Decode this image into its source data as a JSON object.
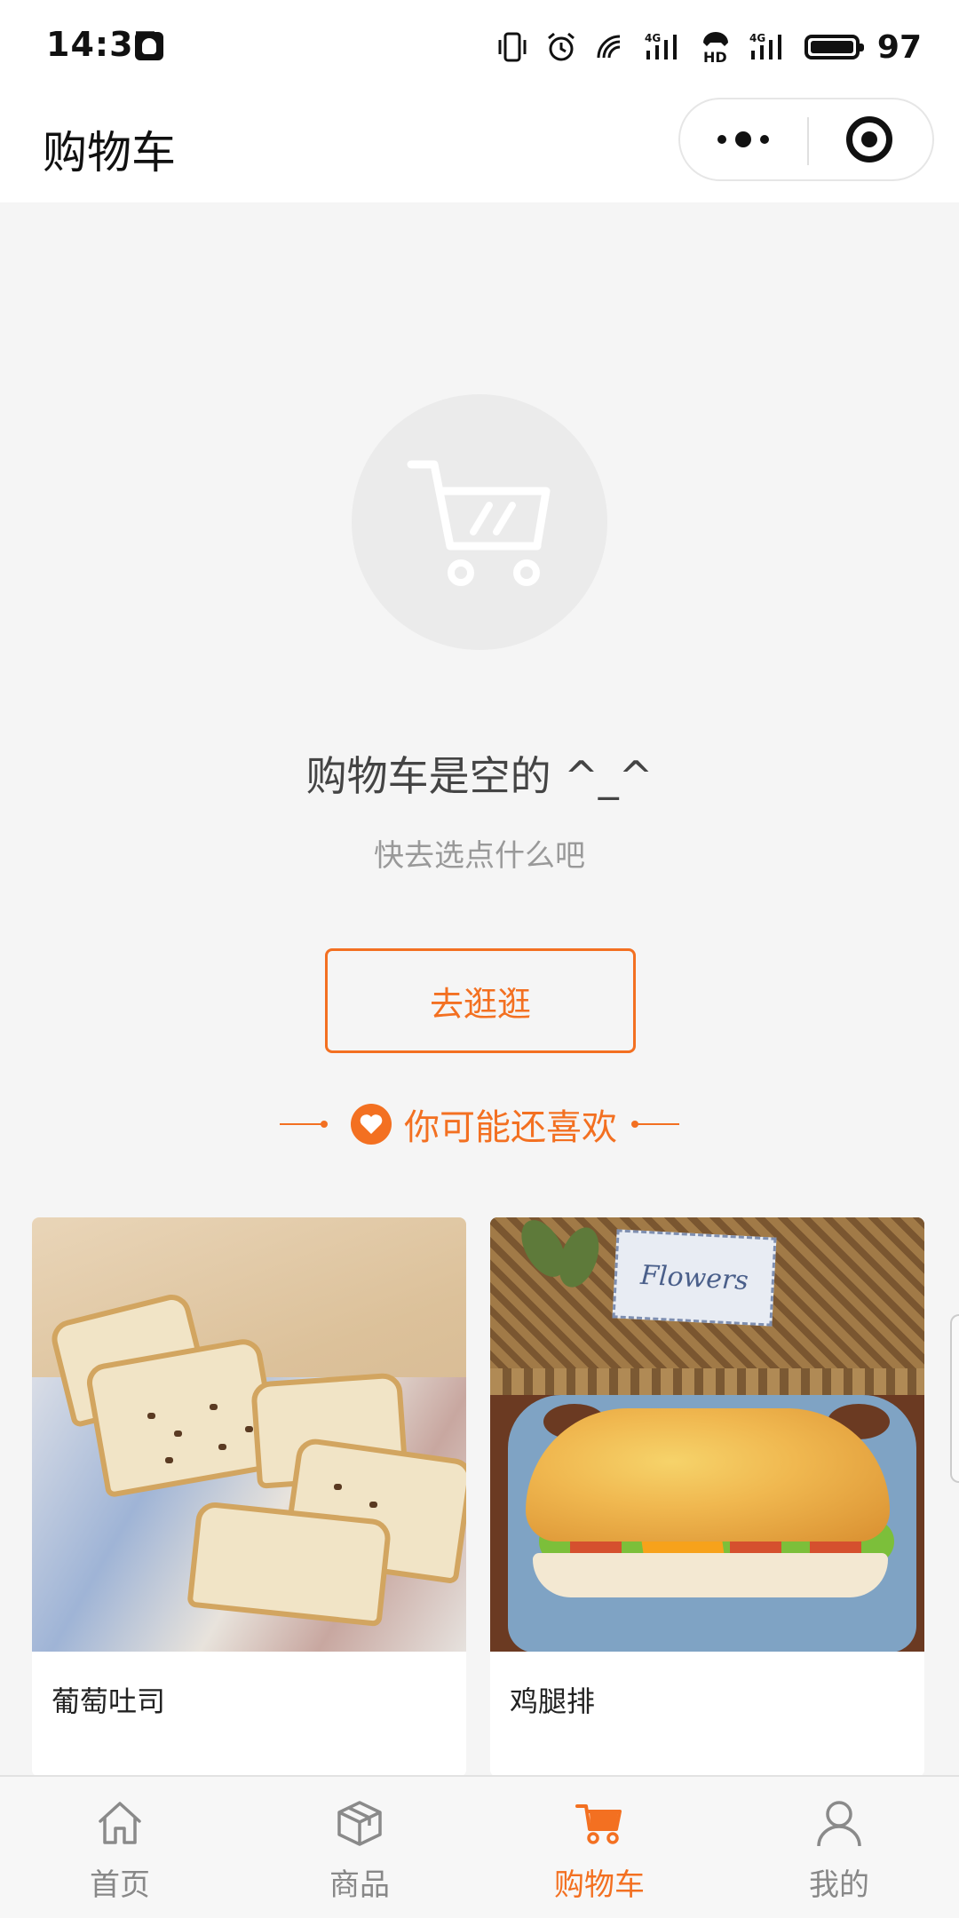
{
  "status_bar": {
    "time": "14:37",
    "battery_level": "97",
    "icons": [
      "qq-notification-icon",
      "vibrate-icon",
      "alarm-icon",
      "wifi-icon",
      "signal-4g-icon",
      "hd-voice-icon",
      "signal-4g-icon",
      "battery-icon"
    ]
  },
  "header": {
    "title": "购物车",
    "capsule": {
      "more_icon": "more-dots-icon",
      "close_icon": "target-close-icon"
    }
  },
  "empty_cart": {
    "icon": "shopping-cart-icon",
    "title": "购物车是空的 ^_^",
    "subtitle": "快去选点什么吧",
    "button_label": "去逛逛"
  },
  "recommend": {
    "title": "你可能还喜欢",
    "icon": "heart-icon",
    "products": [
      {
        "name": "葡萄吐司"
      },
      {
        "name": "鸡腿排",
        "image_text": "Flowers"
      }
    ]
  },
  "tabbar": {
    "items": [
      {
        "label": "首页",
        "icon": "home-icon"
      },
      {
        "label": "商品",
        "icon": "box-icon"
      },
      {
        "label": "购物车",
        "icon": "cart-icon",
        "active": true
      },
      {
        "label": "我的",
        "icon": "user-icon"
      }
    ]
  },
  "colors": {
    "accent": "#f37021",
    "background": "#f5f5f5",
    "text": "#333333"
  }
}
